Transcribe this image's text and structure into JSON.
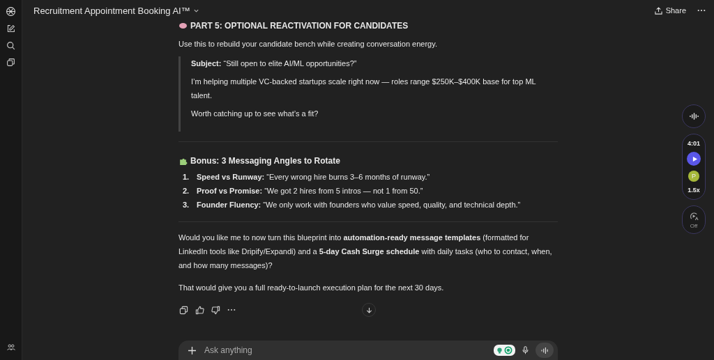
{
  "header": {
    "title": "Recruitment Appointment Booking AI™",
    "share": "Share"
  },
  "message": {
    "heading": "PART 5: OPTIONAL REACTIVATION FOR CANDIDATES",
    "intro": "Use this to rebuild your candidate bench while creating conversation energy.",
    "quote": [
      "**Subject:** “Still open to elite AI/ML opportunities?”",
      "I’m helping multiple VC-backed startups scale right now — roles range $250K–$400K base for top ML talent.",
      "Worth catching up to see what’s a fit?"
    ],
    "bonus_heading": "Bonus: 3 Messaging Angles to Rotate",
    "angles": [
      {
        "number": "1.",
        "text": "**Speed vs Runway:** “Every wrong hire burns 3–6 months of runway.”"
      },
      {
        "number": "2.",
        "text": "**Proof vs Promise:** “We got 2 hires from 5 intros — not 1 from 50.”"
      },
      {
        "number": "3.",
        "text": "**Founder Fluency:** “We only work with founders who value speed, quality, and technical depth.”"
      }
    ],
    "closing": [
      "Would you like me to now turn this blueprint into **automation-ready message templates** (formatted for LinkedIn tools like Dripify/Expandi) and a **5-day Cash Surge schedule** with daily tasks (who to contact, when, and how many messages)?",
      "That would give you a full ready-to-launch execution plan for the next 30 days."
    ]
  },
  "composer": {
    "placeholder": "Ask anything"
  },
  "player": {
    "time": "4:01",
    "avatar": "P",
    "speed": "1.5x",
    "autoplay": "Off"
  }
}
